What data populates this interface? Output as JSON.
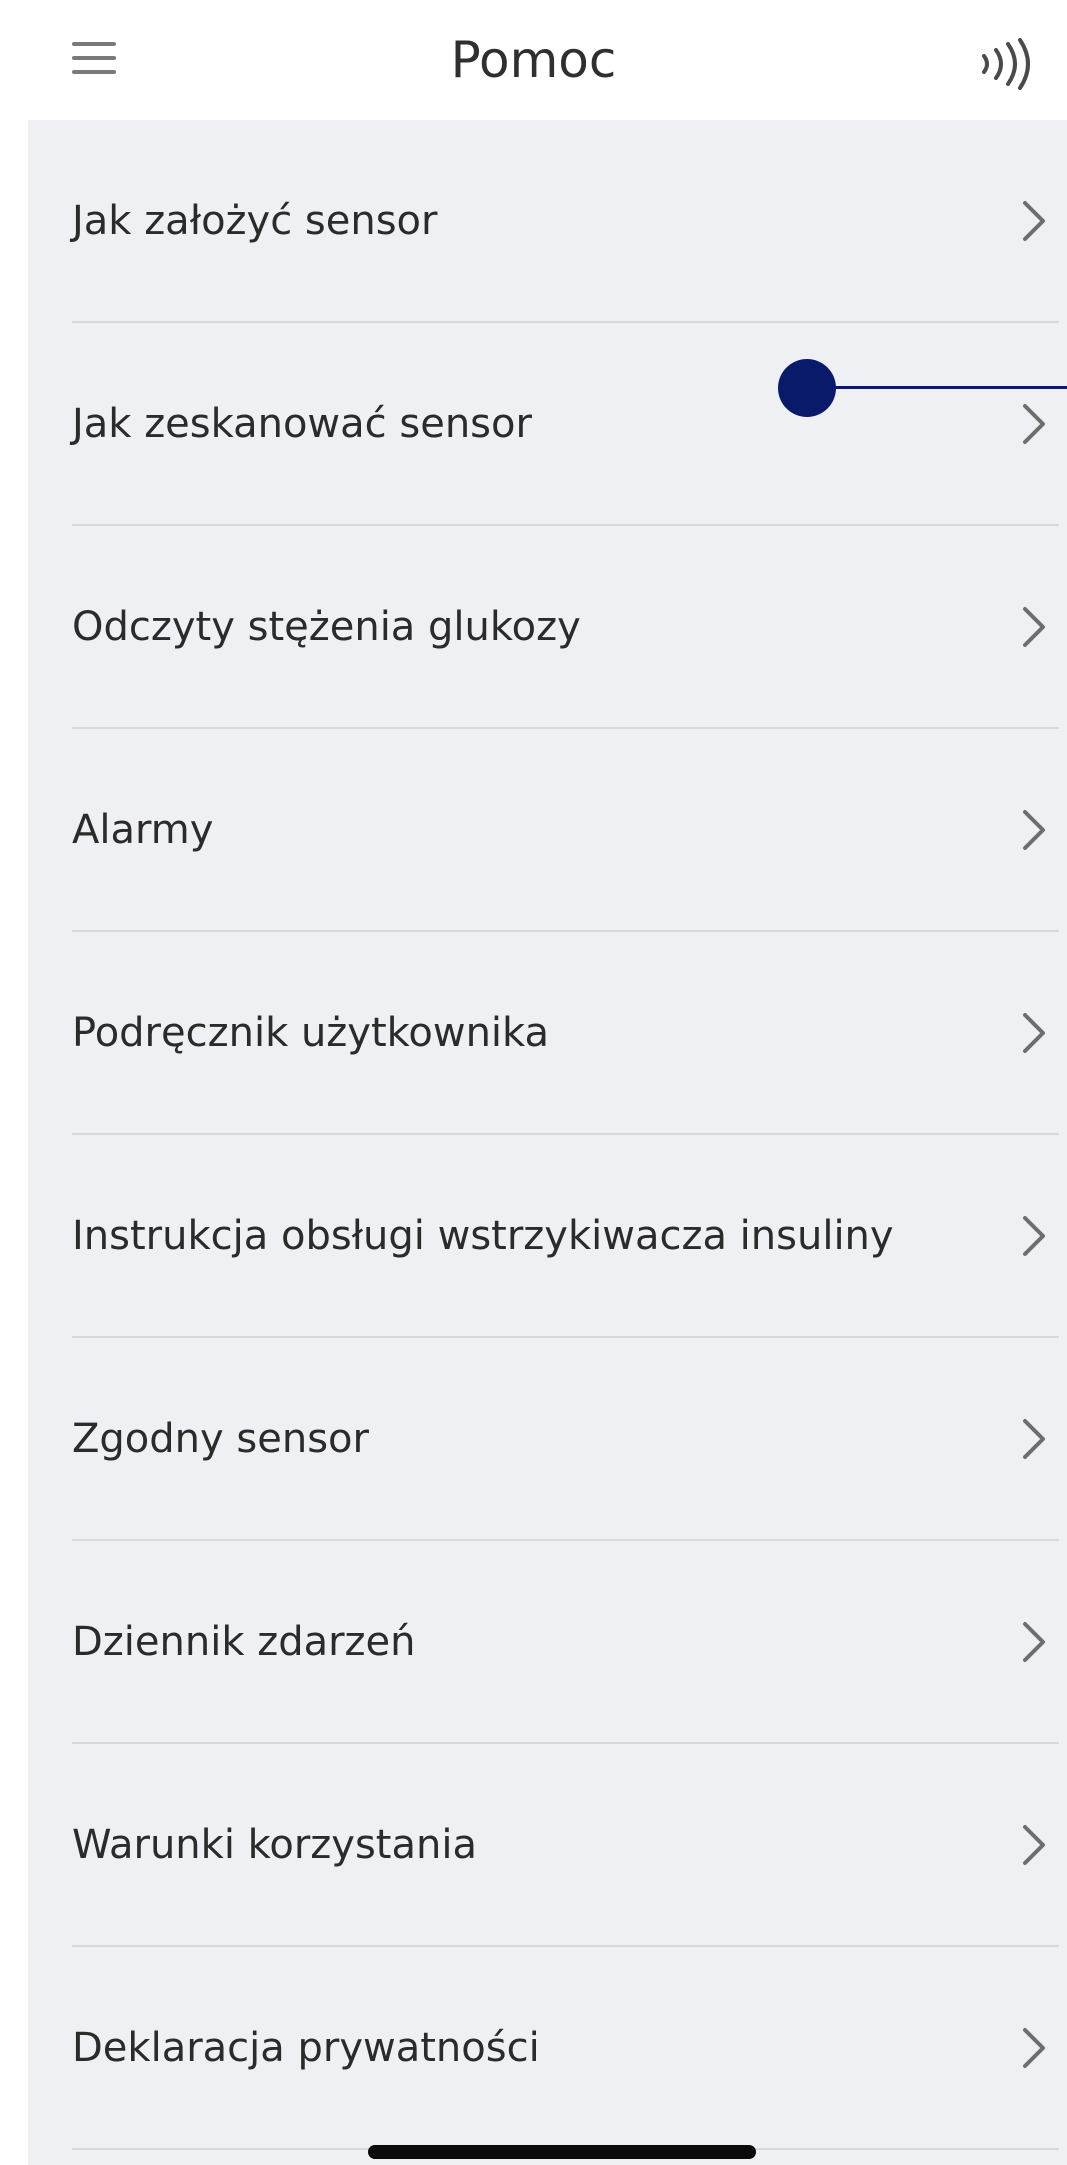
{
  "header": {
    "title": "Pomoc",
    "left_icon": "hamburger-menu-icon",
    "right_icon": "nfc-scan-icon"
  },
  "menu": {
    "items": [
      {
        "label": "Jak założyć sensor",
        "icon": "chevron-right-icon"
      },
      {
        "label": "Jak zeskanować sensor",
        "icon": "chevron-right-icon"
      },
      {
        "label": "Odczyty stężenia glukozy",
        "icon": "chevron-right-icon"
      },
      {
        "label": "Alarmy",
        "icon": "chevron-right-icon"
      },
      {
        "label": "Podręcznik użytkownika",
        "icon": "chevron-right-icon"
      },
      {
        "label": "Instrukcja obsługi wstrzykiwacza insuliny",
        "icon": "chevron-right-icon"
      },
      {
        "label": "Zgodny sensor",
        "icon": "chevron-right-icon"
      },
      {
        "label": "Dziennik zdarzeń",
        "icon": "chevron-right-icon"
      },
      {
        "label": "Warunki korzystania",
        "icon": "chevron-right-icon"
      },
      {
        "label": "Deklaracja prywatności",
        "icon": "chevron-right-icon"
      }
    ]
  },
  "colors": {
    "list_background": "#eff0f3",
    "text": "#2b2b2b",
    "annotation_marker": "#0a1a6b"
  }
}
